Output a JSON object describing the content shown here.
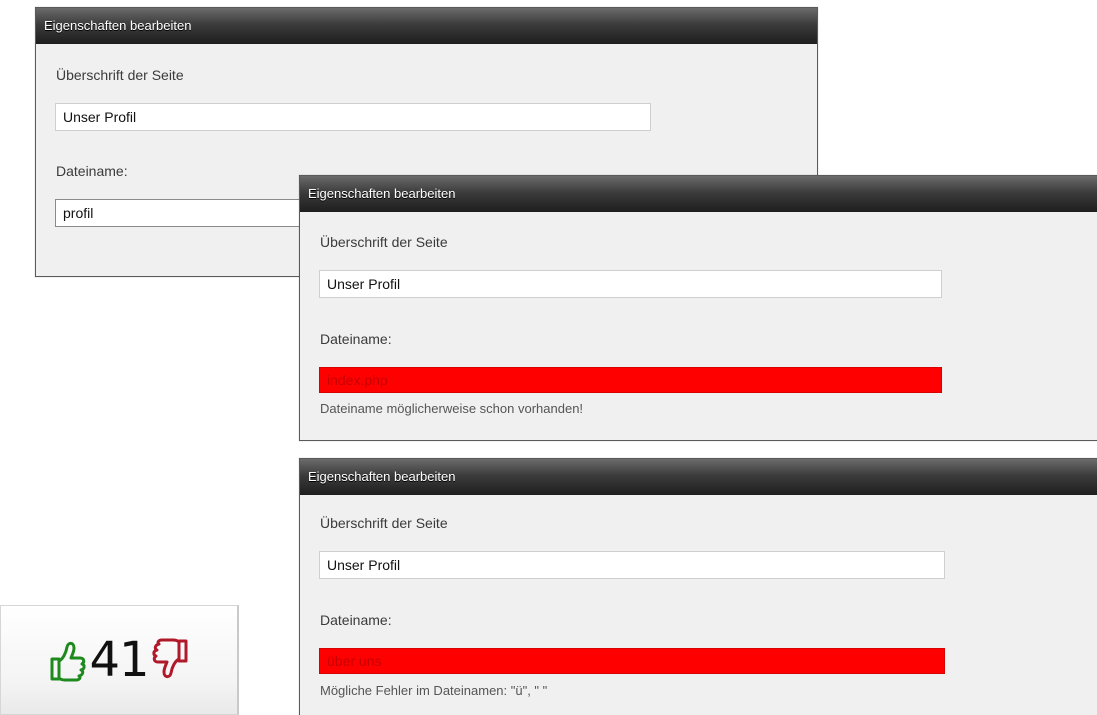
{
  "dialogs": [
    {
      "title": "Eigenschaften bearbeiten",
      "heading_label": "Überschrift der Seite",
      "heading_value": "Unser Profil",
      "filename_label": "Dateiname:",
      "filename_value": "profil"
    },
    {
      "title": "Eigenschaften bearbeiten",
      "heading_label": "Überschrift der Seite",
      "heading_value": "Unser Profil",
      "filename_label": "Dateiname:",
      "filename_value": "index.php",
      "hint": "Dateiname möglicherweise schon vorhanden!"
    },
    {
      "title": "Eigenschaften bearbeiten",
      "heading_label": "Überschrift der Seite",
      "heading_value": "Unser Profil",
      "filename_label": "Dateiname:",
      "filename_value": "über uns",
      "hint": "Mögliche Fehler im Dateinamen: \"ü\", \" \""
    }
  ],
  "rating": {
    "count": "41",
    "up_icon": "thumbs-up-icon",
    "down_icon": "thumbs-down-icon",
    "up_color": "#1e8a1e",
    "down_color": "#b0192a"
  },
  "colors": {
    "error_background": "#ff0000",
    "titlebar": "#2a2a2a"
  }
}
